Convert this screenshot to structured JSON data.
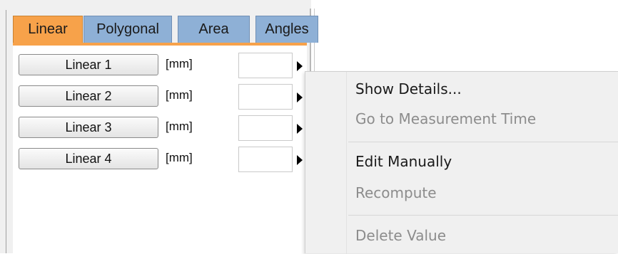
{
  "tabs": [
    {
      "label": "Linear",
      "active": true
    },
    {
      "label": "Polygonal",
      "active": false
    },
    {
      "label": "Area",
      "active": false
    },
    {
      "label": "Angles",
      "active": false
    }
  ],
  "measurements": [
    {
      "label": "Linear 1",
      "unit": "[mm]",
      "value": ""
    },
    {
      "label": "Linear 2",
      "unit": "[mm]",
      "value": ""
    },
    {
      "label": "Linear 3",
      "unit": "[mm]",
      "value": ""
    },
    {
      "label": "Linear 4",
      "unit": "[mm]",
      "value": ""
    }
  ],
  "context_menu": {
    "items": [
      {
        "label": "Show Details...",
        "enabled": true
      },
      {
        "label": "Go to Measurement Time",
        "enabled": false
      },
      {
        "label": "Edit Manually",
        "enabled": true
      },
      {
        "label": "Recompute",
        "enabled": false
      },
      {
        "label": "Delete Value",
        "enabled": false
      }
    ]
  },
  "colors": {
    "active_tab": "#f7a24a",
    "inactive_tab": "#8eb0d6",
    "disabled_text": "#8c8c8c"
  }
}
